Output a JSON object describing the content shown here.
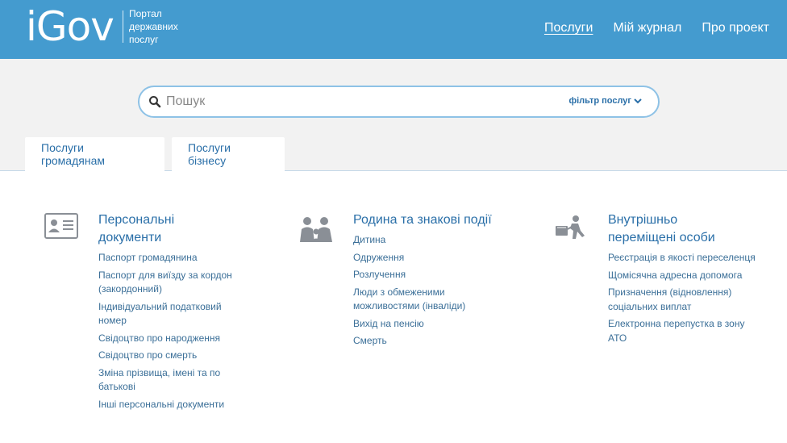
{
  "header": {
    "logo": "iGov",
    "logo_sub": [
      "Портал",
      "державних",
      "послуг"
    ],
    "nav": [
      {
        "label": "Послуги",
        "active": true
      },
      {
        "label": "Мій журнал",
        "active": false
      },
      {
        "label": "Про проект",
        "active": false
      }
    ]
  },
  "search": {
    "placeholder": "Пошук",
    "filter_label": "фільтр послуг"
  },
  "tabs": [
    {
      "label": "Послуги громадянам"
    },
    {
      "label": "Послуги бізнесу"
    }
  ],
  "categories": [
    {
      "icon": "id-card-icon",
      "title": "Персональні документи",
      "items": [
        "Паспорт громадянина",
        "Паспорт для виїзду за кордон (закордонний)",
        "Індивідуальний податковий номер",
        "Свідоцтво про народження",
        "Свідоцтво про смерть",
        "Зміна прізвища, імені та по батькові",
        "Інші персональні документи"
      ]
    },
    {
      "icon": "family-icon",
      "title": "Родина та знакові події",
      "items": [
        "Дитина",
        "Одруження",
        "Розлучення",
        "Люди з обмеженими можливостями (інваліди)",
        "Вихід на пенсію",
        "Смерть"
      ]
    },
    {
      "icon": "displaced-person-icon",
      "title": "Внутрішньо переміщені особи",
      "items": [
        "Реєстрація в якості переселенця",
        "Щомісячна адресна допомога",
        "Призначення (відновлення) соціальних виплат",
        "Електронна перепустка в зону АТО"
      ]
    }
  ],
  "colors": {
    "header_bg": "#449bcf",
    "link": "#2a6fa8",
    "search_border": "#8ec2e6"
  }
}
